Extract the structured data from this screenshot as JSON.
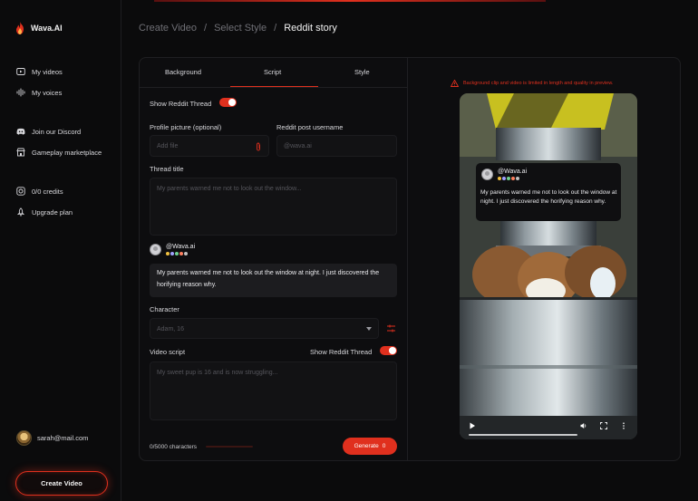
{
  "app": {
    "name": "Wava.AI"
  },
  "sidebar": {
    "items": [
      {
        "label": "My videos",
        "icon": "video-play-icon"
      },
      {
        "label": "My voices",
        "icon": "waveform-icon"
      },
      {
        "label": "Join our Discord",
        "icon": "discord-icon"
      },
      {
        "label": "Gameplay marketplace",
        "icon": "store-icon"
      },
      {
        "label": "0/0 credits",
        "icon": "credits-icon"
      },
      {
        "label": "Upgrade plan",
        "icon": "rocket-icon"
      }
    ],
    "user_email": "sarah@mail.com",
    "create_label": "Create Video"
  },
  "breadcrumb": {
    "items": [
      "Create Video",
      "Select Style"
    ],
    "current": "Reddit story",
    "separator": "/"
  },
  "tabs": [
    {
      "label": "Background"
    },
    {
      "label": "Script",
      "active": true
    },
    {
      "label": "Style"
    }
  ],
  "form": {
    "show_thread_label": "Show Reddit Thread",
    "show_thread_on": true,
    "profile_label": "Profile picture (optional)",
    "profile_placeholder": "Add file",
    "username_label": "Reddit post username",
    "username_placeholder": "@wava.ai",
    "thread_title_label": "Thread title",
    "thread_title_placeholder": "My parents warned me not to look out the window...",
    "preview_username": "@Wava.ai",
    "preview_text": "My parents warned me not to look out the window at night. I just discovered the horifying reason why.",
    "character_label": "Character",
    "character_value": "Adam, 16",
    "script_label": "Video script",
    "script_toggle_label": "Show Reddit Thread",
    "script_toggle_on": true,
    "script_placeholder": "My sweet pup is 16 and is now struggling...",
    "char_count": "0/5000 characters",
    "char_progress": 0,
    "generate_label": "Generate",
    "generate_cost": "0"
  },
  "preview": {
    "warning": "Background clip and video is limited in length and quality in preview.",
    "card_username": "@Wava.ai",
    "card_text": "My parents warned me not to look out the window at night. I just discovered the horifying reason why."
  },
  "colors": {
    "accent": "#e0301e",
    "bg": "#0b0b0c",
    "panel": "#0d0d0f",
    "field": "#121214"
  }
}
